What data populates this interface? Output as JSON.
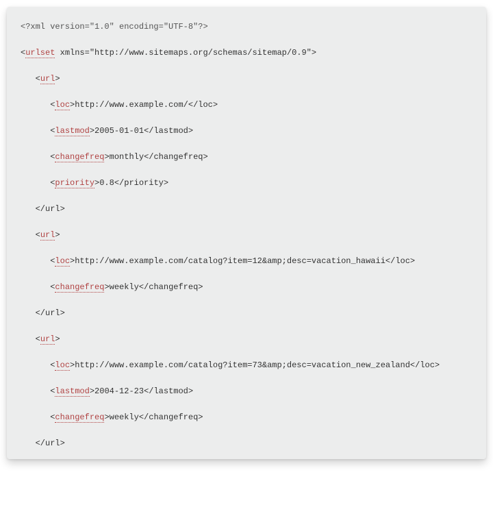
{
  "code": {
    "xml_decl": "<?xml version=\"1.0\" encoding=\"UTF-8\"?>",
    "urlset_open_prefix": "<",
    "urlset_tag": "urlset",
    "urlset_attrs": " xmlns=\"http://www.sitemaps.org/schemas/sitemap/0.9\">",
    "url_open_prefix": "<",
    "url_tag": "url",
    "url_open_suffix": ">",
    "url_close": "</url>",
    "loc_open_prefix": "<",
    "loc_tag": "loc",
    "loc_open_suffix": ">",
    "loc_close": "</loc>",
    "lastmod_open_prefix": "<",
    "lastmod_tag": "lastmod",
    "lastmod_open_suffix": ">",
    "lastmod_close": "</lastmod>",
    "changefreq_open_prefix": "<",
    "changefreq_tag": "changefreq",
    "changefreq_open_suffix": ">",
    "changefreq_close": "</changefreq>",
    "priority_open_prefix": "<",
    "priority_tag": "priority",
    "priority_open_suffix": ">",
    "priority_close": "</priority>",
    "entries": {
      "0": {
        "loc": "http://www.example.com/",
        "lastmod": "2005-01-01",
        "changefreq": "monthly",
        "priority": "0.8"
      },
      "1": {
        "loc": "http://www.example.com/catalog?item=12&amp;desc=vacation_hawaii",
        "changefreq": "weekly"
      },
      "2": {
        "loc": "http://www.example.com/catalog?item=73&amp;desc=vacation_new_zealand",
        "lastmod": "2004-12-23",
        "changefreq": "weekly"
      }
    }
  }
}
